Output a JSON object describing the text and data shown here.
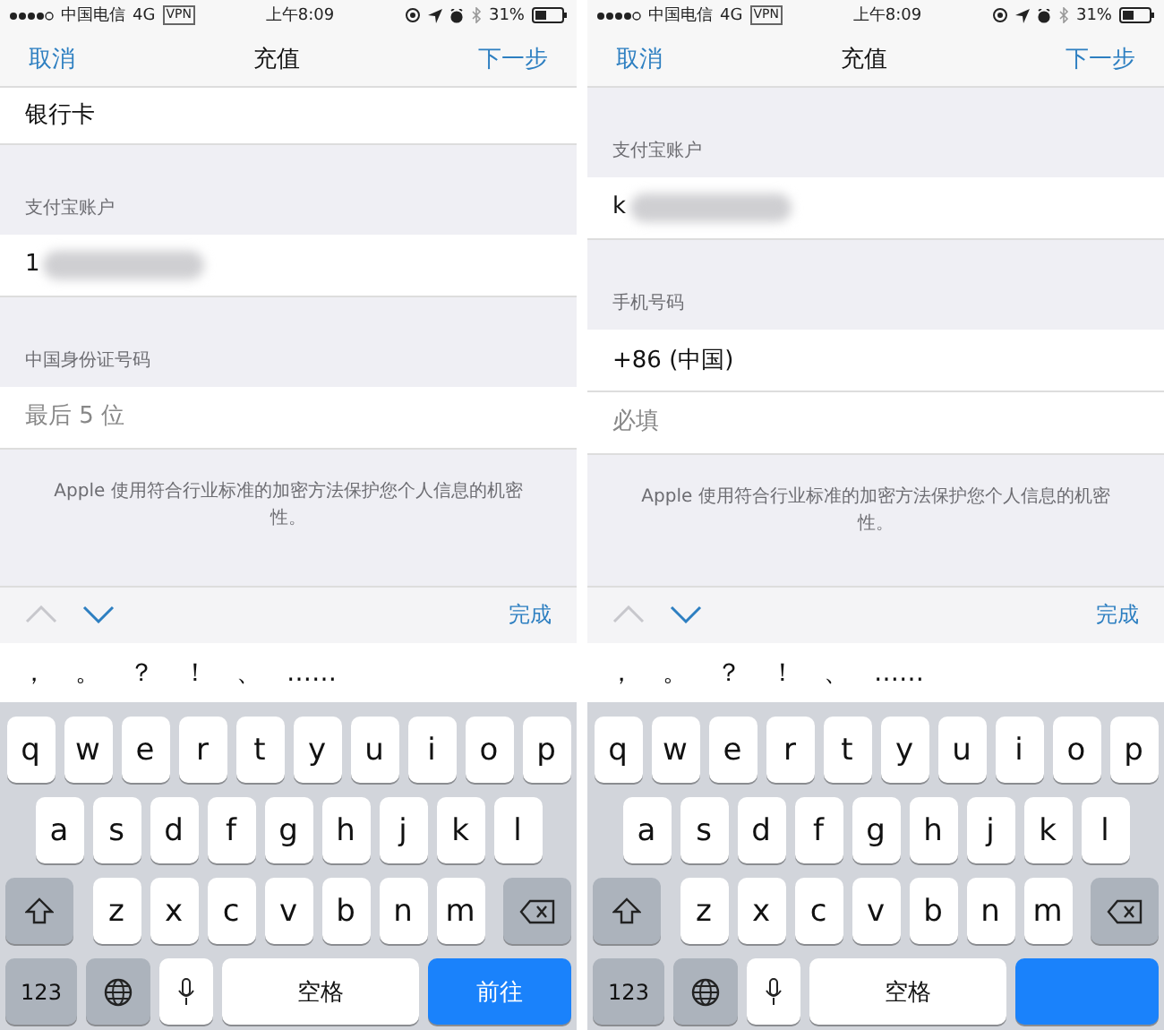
{
  "screens": [
    {
      "status_bar": {
        "carrier": "中国电信",
        "network": "4G",
        "vpn": "VPN",
        "time": "上午8:09",
        "battery": "31%"
      },
      "nav": {
        "left": "取消",
        "title": "充值",
        "right": "下一步"
      },
      "form": [
        {
          "kind": "text_row",
          "text": "银行卡"
        },
        {
          "kind": "section_label",
          "text": "支付宝账户"
        },
        {
          "kind": "value_row",
          "text": "1",
          "redacted": true
        },
        {
          "kind": "section_label",
          "text": "中国身份证号码"
        },
        {
          "kind": "input_row",
          "placeholder": "最后 5 位"
        }
      ],
      "footer": "Apple 使用符合行业标准的加密方法保护您个人信息的机密性。",
      "accessory": {
        "previous_disabled": true,
        "next_disabled": false,
        "done": "完成"
      },
      "suggestions": [
        "，",
        "。",
        "？",
        "！",
        "、",
        "……"
      ],
      "keyboard": {
        "rows": [
          [
            "q",
            "w",
            "e",
            "r",
            "t",
            "y",
            "u",
            "i",
            "o",
            "p"
          ],
          [
            "a",
            "s",
            "d",
            "f",
            "g",
            "h",
            "j",
            "k",
            "l"
          ],
          [
            "z",
            "x",
            "c",
            "v",
            "b",
            "n",
            "m"
          ]
        ],
        "numbers": "123",
        "space": "空格",
        "return": "前往"
      }
    },
    {
      "status_bar": {
        "carrier": "中国电信",
        "network": "4G",
        "vpn": "VPN",
        "time": "上午8:09",
        "battery": "31%"
      },
      "nav": {
        "left": "取消",
        "title": "充值",
        "right": "下一步"
      },
      "form": [
        {
          "kind": "section_label",
          "text": "支付宝账户"
        },
        {
          "kind": "value_row",
          "text": "k",
          "redacted": true
        },
        {
          "kind": "section_label",
          "text": "手机号码"
        },
        {
          "kind": "text_row",
          "text": "+86 (中国)"
        },
        {
          "kind": "input_row",
          "placeholder": "必填"
        }
      ],
      "footer": "Apple 使用符合行业标准的加密方法保护您个人信息的机密性。",
      "accessory": {
        "previous_disabled": true,
        "next_disabled": false,
        "done": "完成"
      },
      "suggestions": [
        "，",
        "。",
        "？",
        "！",
        "、",
        "……"
      ],
      "keyboard": {
        "rows": [
          [
            "q",
            "w",
            "e",
            "r",
            "t",
            "y",
            "u",
            "i",
            "o",
            "p"
          ],
          [
            "a",
            "s",
            "d",
            "f",
            "g",
            "h",
            "j",
            "k",
            "l"
          ],
          [
            "z",
            "x",
            "c",
            "v",
            "b",
            "n",
            "m"
          ]
        ],
        "numbers": "123",
        "space": "空格"
      }
    }
  ]
}
